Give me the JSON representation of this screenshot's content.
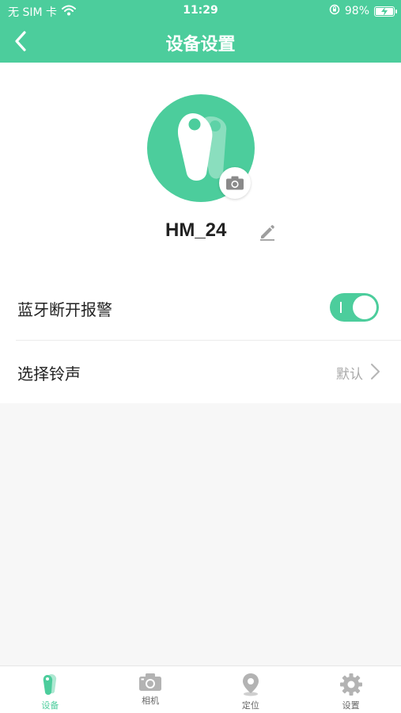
{
  "status_bar": {
    "carrier": "无 SIM 卡",
    "time": "11:29",
    "battery": "98%"
  },
  "nav": {
    "title": "设备设置"
  },
  "device": {
    "name": "HM_24"
  },
  "settings": {
    "bluetooth_alarm": {
      "label": "蓝牙断开报警",
      "enabled": true
    },
    "ringtone": {
      "label": "选择铃声",
      "value": "默认"
    }
  },
  "tabs": [
    {
      "label": "设备",
      "icon": "device-icon",
      "active": true
    },
    {
      "label": "相机",
      "icon": "camera-icon",
      "active": false
    },
    {
      "label": "定位",
      "icon": "location-pin-icon",
      "active": false
    },
    {
      "label": "设置",
      "icon": "gear-icon",
      "active": false
    }
  ],
  "colors": {
    "accent": "#4ccd9c",
    "tab_inactive": "#b3b3b3"
  }
}
